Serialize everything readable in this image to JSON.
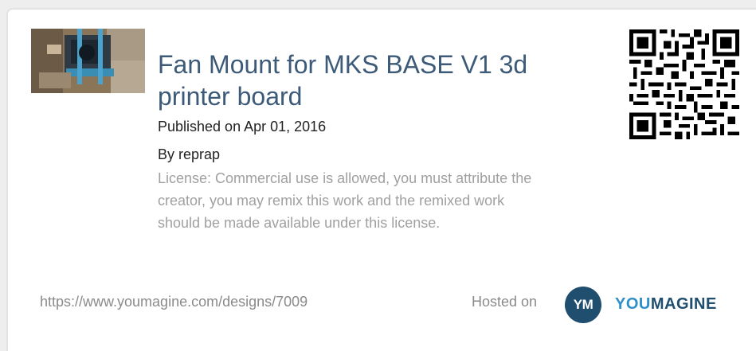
{
  "design": {
    "title": "Fan Mount for MKS BASE V1 3d printer board",
    "published": "Published on Apr 01, 2016",
    "author": "By reprap",
    "license": "License: Commercial use is allowed, you must attribute the creator, you may remix this work and the remixed work should be made available under this license.",
    "url": "https://www.youmagine.com/designs/7009"
  },
  "footer": {
    "hosted_label": "Hosted on",
    "logo_initials": "YM",
    "logo_word_a": "YOU",
    "logo_word_b": "MAGINE"
  },
  "colors": {
    "title": "#3d5a78",
    "license": "#a0a0a0",
    "logo_dark": "#1f4e6e",
    "logo_light": "#2f8fc9"
  }
}
